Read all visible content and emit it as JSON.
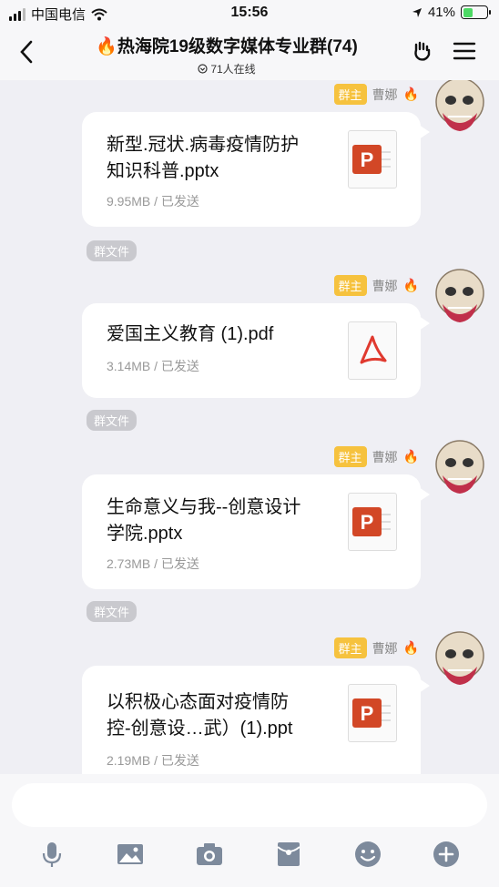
{
  "status": {
    "carrier": "中国电信",
    "time": "15:56",
    "battery": "41%",
    "battery_level": 0.41
  },
  "header": {
    "title": "热海院19级数字媒体专业群(74)",
    "online": "71人在线"
  },
  "messages": [
    {
      "badge": "群主",
      "sender": "曹娜",
      "file_line1": "新型.冠状.病毒疫情防护",
      "file_line2": "知识科普.pptx",
      "size": "9.95MB / 已发送",
      "icon": "powerpoint-icon",
      "tag": "群文件"
    },
    {
      "badge": "群主",
      "sender": "曹娜",
      "file_line1": "爱国主义教育 (1).pdf",
      "file_line2": "",
      "size": "3.14MB / 已发送",
      "icon": "pdf-icon",
      "tag": "群文件"
    },
    {
      "badge": "群主",
      "sender": "曹娜",
      "file_line1": "生命意义与我--创意设计",
      "file_line2": "学院.pptx",
      "size": "2.73MB / 已发送",
      "icon": "powerpoint-icon",
      "tag": "群文件"
    },
    {
      "badge": "群主",
      "sender": "曹娜",
      "file_line1": "以积极心态面对疫情防",
      "file_line2": "控-创意设…武）(1).ppt",
      "size": "2.19MB / 已发送",
      "icon": "powerpoint-icon"
    }
  ],
  "toolbar": [
    "microphone-icon",
    "image-icon",
    "camera-icon",
    "red-packet-icon",
    "emoji-icon",
    "plus-icon"
  ],
  "colors": {
    "badge": "#f6c23e",
    "ppt": "#d24726",
    "pdf": "#e03a2f",
    "tag": "#c9c9ce"
  }
}
